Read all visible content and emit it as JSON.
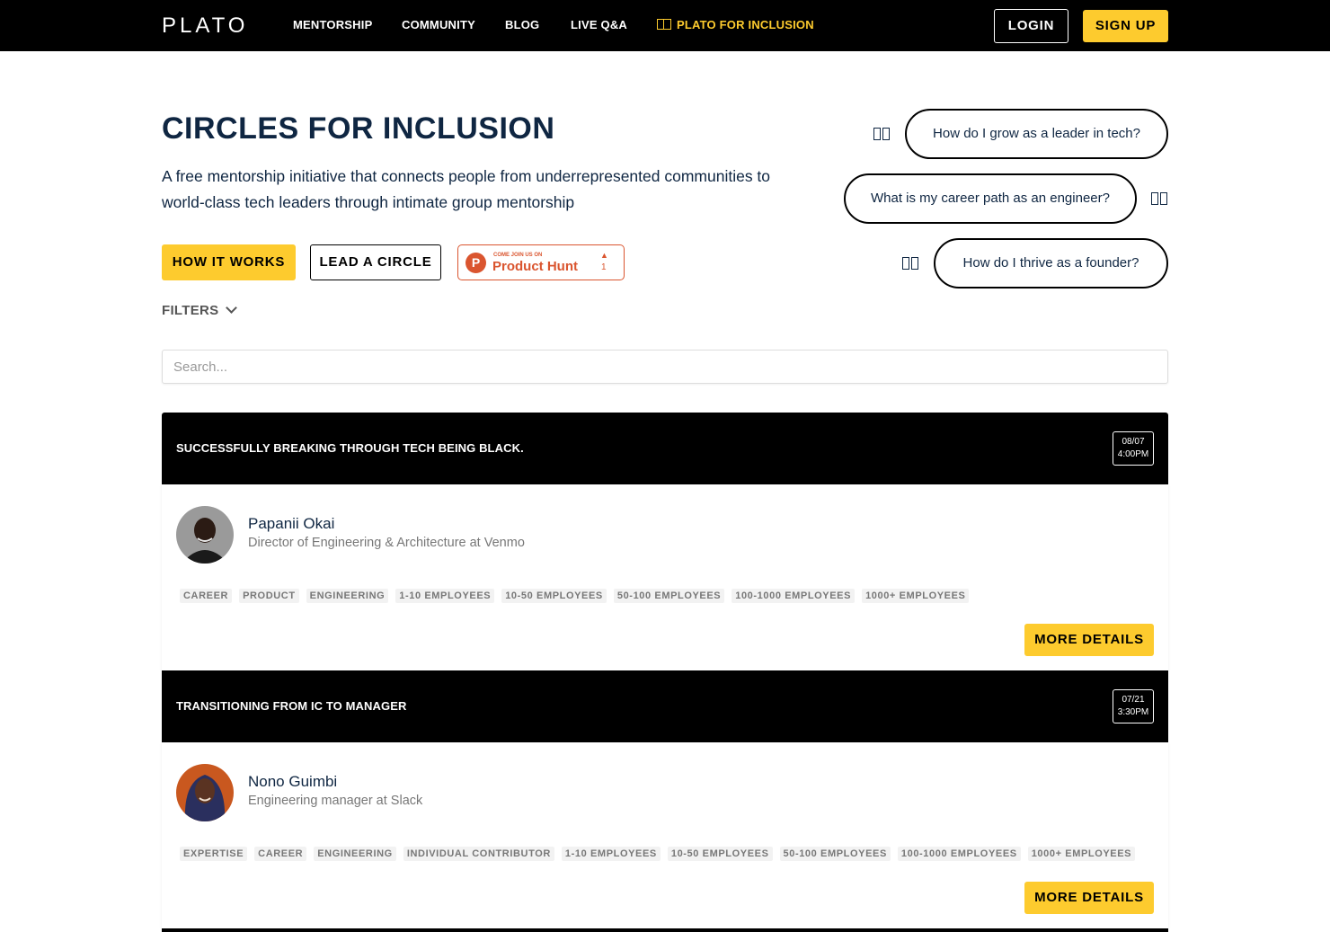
{
  "nav": {
    "logo": "PLATO",
    "links": [
      "MENTORSHIP",
      "COMMUNITY",
      "BLOG",
      "LIVE Q&A"
    ],
    "inclusion": "PLATO FOR INCLUSION",
    "login": "LOGIN",
    "signup": "SIGN UP"
  },
  "hero": {
    "title": "CIRCLES FOR INCLUSION",
    "subtitle": "A free mentorship initiative that connects people from underrepresented communities to world-class tech leaders through intimate group mentorship",
    "how_it_works": "HOW IT WORKS",
    "lead_circle": "LEAD A CIRCLE",
    "product_hunt": {
      "small": "COME JOIN US ON",
      "name": "Product Hunt",
      "count": "1"
    }
  },
  "bubbles": [
    "How do I grow as a leader in tech?",
    "What is my career path as an engineer?",
    "How do I thrive as a founder?"
  ],
  "filters": {
    "label": "FILTERS"
  },
  "search": {
    "placeholder": "Search..."
  },
  "circles": [
    {
      "title": "SUCCESSFULLY BREAKING THROUGH TECH BEING BLACK.",
      "date": "08/07",
      "time": "4:00PM",
      "mentor": "Papanii Okai",
      "role": "Director of Engineering & Architecture at Venmo",
      "tags": [
        "CAREER",
        "PRODUCT",
        "ENGINEERING",
        "1-10 EMPLOYEES",
        "10-50 EMPLOYEES",
        "50-100 EMPLOYEES",
        "100-1000 EMPLOYEES",
        "1000+ EMPLOYEES"
      ],
      "more": "MORE DETAILS"
    },
    {
      "title": "TRANSITIONING FROM IC TO MANAGER",
      "date": "07/21",
      "time": "3:30PM",
      "mentor": "Nono Guimbi",
      "role": "Engineering manager at Slack",
      "tags": [
        "EXPERTISE",
        "CAREER",
        "ENGINEERING",
        "INDIVIDUAL CONTRIBUTOR",
        "1-10 EMPLOYEES",
        "10-50 EMPLOYEES",
        "50-100 EMPLOYEES",
        "100-1000 EMPLOYEES",
        "1000+ EMPLOYEES"
      ],
      "more": "MORE DETAILS"
    }
  ]
}
